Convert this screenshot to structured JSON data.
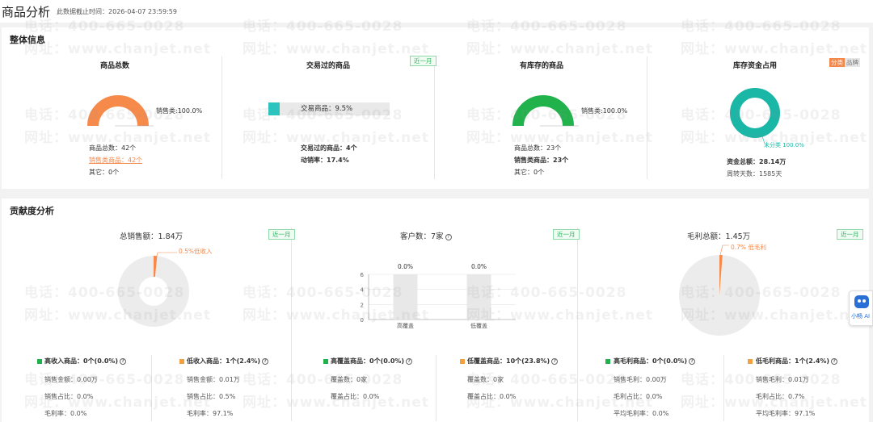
{
  "header": {
    "title": "商品分析",
    "subtitle": "此数据截止时间：2026-04-07 23:59:59"
  },
  "overview": {
    "title": "整体信息",
    "total_goods": {
      "title": "商品总数",
      "donut_label": "销售类:100.0%",
      "donut_fraction": 1.0,
      "donut_color": "#f58a4b",
      "line1": "商品总数：42个",
      "line2": "销售类商品：42个",
      "line3": "其它：0个"
    },
    "traded_goods": {
      "title": "交易过的商品",
      "badge": "近一月",
      "bar_label": "交易商品：9.5%",
      "bar_fraction": 0.095,
      "bar_color": "#2cc4be",
      "line1": "交易过的商品：4个",
      "line2": "动销率：17.4%"
    },
    "stocked_goods": {
      "title": "有库存的商品",
      "donut_label": "销售类:100.0%",
      "donut_fraction": 1.0,
      "donut_color": "#22b24c",
      "line1": "商品总数：23个",
      "line2": "销售类商品：23个",
      "line3": "其它：0个"
    },
    "inventory_funds": {
      "title": "库存资金占用",
      "toggle_on": "分类",
      "toggle_off": "品牌",
      "ring_label": "未分类 100.0%",
      "ring_fraction": 1.0,
      "ring_color": "#1ab6a6",
      "line1": "资金总额：28.14万",
      "line2": "周转天数：1585天"
    }
  },
  "contribution": {
    "title": "贡献度分析",
    "sales": {
      "title": "总销售额：1.84万",
      "badge": "近一月",
      "slice_label": "0.5%低收入",
      "slice_percent": 0.5,
      "slice_color": "#f58a4b",
      "base_color": "#ececec",
      "left_legend": {
        "label": "高收入商品：0个(0.0%)",
        "color": "#22b24c"
      },
      "left_lines": [
        "销售金额：0.00万",
        "销售占比：0.0%",
        "毛利率：0.0%"
      ],
      "right_legend": {
        "label": "低收入商品：1个(2.4%)",
        "color": "#f2a040"
      },
      "right_lines": [
        "销售金额：0.01万",
        "销售占比：0.5%",
        "毛利率：97.1%"
      ]
    },
    "customers": {
      "title": "客户数：7家",
      "badge": "近一月",
      "chart_data": {
        "type": "bar",
        "categories": [
          "高覆盖",
          "低覆盖"
        ],
        "values": [
          6,
          6
        ],
        "data_labels": [
          "0.0%",
          "0.0%"
        ],
        "y_ticks": [
          "0",
          "2",
          "4",
          "6"
        ],
        "ylim": [
          0,
          6
        ],
        "bar_color": "#e8e8e8"
      },
      "left_legend": {
        "label": "高覆盖商品：0个(0.0%)",
        "color": "#22b24c"
      },
      "left_lines": [
        "覆盖数：0家",
        "覆盖占比：0.0%"
      ],
      "right_legend": {
        "label": "低覆盖商品：10个(23.8%)",
        "color": "#f2a040"
      },
      "right_lines": [
        "覆盖数：0家",
        "覆盖占比：0.0%"
      ]
    },
    "gross_profit": {
      "title": "毛利总额：1.45万",
      "badge": "近一月",
      "slice_label": "0.7% 低毛利",
      "slice_percent": 0.7,
      "slice_color": "#f58a4b",
      "base_color": "#ececec",
      "left_legend": {
        "label": "高毛利商品：0个(0.0%)",
        "color": "#22b24c"
      },
      "left_lines": [
        "销售毛利：0.00万",
        "毛利占比：0.0%",
        "平均毛利率：0.0%"
      ],
      "right_legend": {
        "label": "低毛利商品：1个(2.4%)",
        "color": "#f2a040"
      },
      "right_lines": [
        "销售毛利：0.01万",
        "毛利占比：0.7%",
        "平均毛利率：97.1%"
      ]
    }
  },
  "help_icon": "?",
  "watermark": {
    "line1": "电话：400-665-0028",
    "line2": "网址：www.chanjet.net"
  },
  "assistant": {
    "label": "小畅 AI",
    "icon": "robot-icon"
  }
}
